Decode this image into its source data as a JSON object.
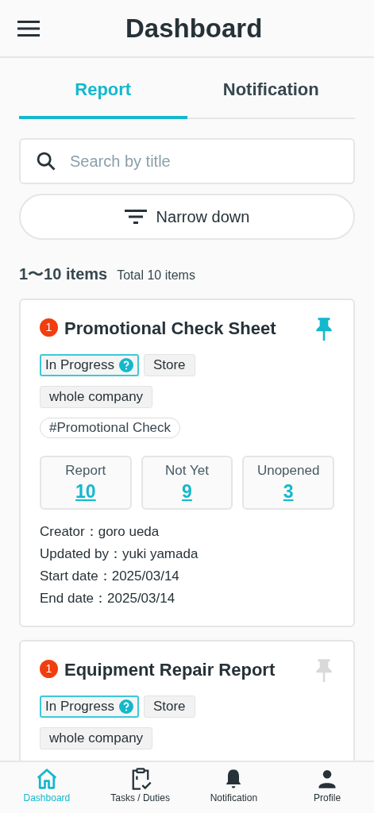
{
  "header": {
    "title": "Dashboard"
  },
  "tabs": [
    {
      "label": "Report",
      "selected": true
    },
    {
      "label": "Notification",
      "selected": false
    }
  ],
  "search": {
    "placeholder": "Search by title"
  },
  "filter_button": {
    "label": "Narrow down"
  },
  "count": {
    "range": "1〜10 items",
    "total": "Total 10 items"
  },
  "cards": [
    {
      "badge": "1",
      "title": "Promotional Check Sheet",
      "pinned": true,
      "status": "In Progress",
      "tags": [
        "Store",
        "whole company"
      ],
      "hashtags": [
        "#Promotional Check"
      ],
      "stats": [
        {
          "label": "Report",
          "value": "10"
        },
        {
          "label": "Not Yet",
          "value": "9"
        },
        {
          "label": "Unopened",
          "value": "3"
        }
      ],
      "meta": [
        "Creator：goro ueda",
        "Updated by：yuki yamada",
        "Start date：2025/03/14",
        "End date：2025/03/14"
      ]
    },
    {
      "badge": "1",
      "title": "Equipment Repair Report",
      "pinned": false,
      "status": "In Progress",
      "tags": [
        "Store",
        "whole company"
      ]
    }
  ],
  "nav": [
    {
      "label": "Dashboard",
      "selected": true
    },
    {
      "label": "Tasks / Duties",
      "selected": false
    },
    {
      "label": "Notification",
      "selected": false
    },
    {
      "label": "Profile",
      "selected": false
    }
  ]
}
